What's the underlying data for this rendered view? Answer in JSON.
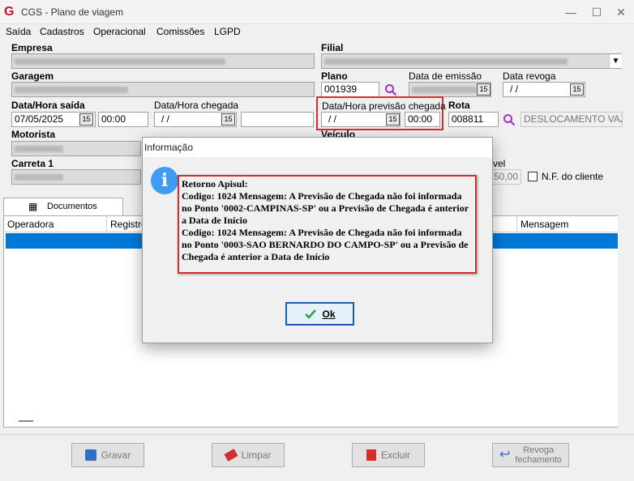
{
  "window": {
    "title": "CGS - Plano de viagem",
    "icon": "cgs-logo-icon",
    "app_letter": "G"
  },
  "menu": [
    "Saída",
    "Cadastros",
    "Operacional",
    "Comissões",
    "LGPD"
  ],
  "form": {
    "empresa_label": "Empresa",
    "filial_label": "Filial",
    "garagem_label": "Garagem",
    "plano_label": "Plano",
    "plano_value": "001939",
    "data_emissao_label": "Data de emissão",
    "data_revoga_label": "Data revoga",
    "data_revoga_value": "/ /",
    "data_saida_label": "Data/Hora saída",
    "data_saida_value": "07/05/2025",
    "hora_saida_value": "00:00",
    "data_chegada_label": "Data/Hora chegada",
    "data_chegada_value": "/ /",
    "previsao_label": "Data/Hora previsão chegada",
    "previsao_data_value": "/ /",
    "previsao_hora_value": "00:00",
    "rota_label": "Rota",
    "rota_code": "008811",
    "rota_desc": "DESLOCAMENTO VAZIO",
    "motorista_label": "Motorista",
    "veiculo_label": "Veículo",
    "carreta_label": "Carreta 1",
    "vel_label": "vel",
    "vel_value": "50,00",
    "nf_label": "N.F. do cliente"
  },
  "tabs": {
    "documentos": "Documentos"
  },
  "table": {
    "headers": [
      "Operadora",
      "Registro",
      "Mensagem"
    ]
  },
  "buttons": {
    "gravar": "Gravar",
    "limpar": "Limpar",
    "excluir": "Excluir",
    "revoga": "Revoga\nfechamento"
  },
  "dialog": {
    "title": "Informação",
    "message": "Retorno Apisul:\nCodigo: 1024 Mensagem: A Previsão de Chegada não foi informada no Ponto '0002-CAMPINAS-SP' ou a Previsão de Chegada é anterior a Data de Início\nCodigo: 1024 Mensagem: A Previsão de Chegada não foi informada no Ponto '0003-SAO BERNARDO DO CAMPO-SP' ou a Previsão de Chegada é anterior a Data de Início",
    "ok_label": "Ok"
  },
  "colors": {
    "accent": "#0078d7",
    "highlight": "#d32f2f",
    "info": "#3d9df2",
    "brand": "#c8102e"
  }
}
